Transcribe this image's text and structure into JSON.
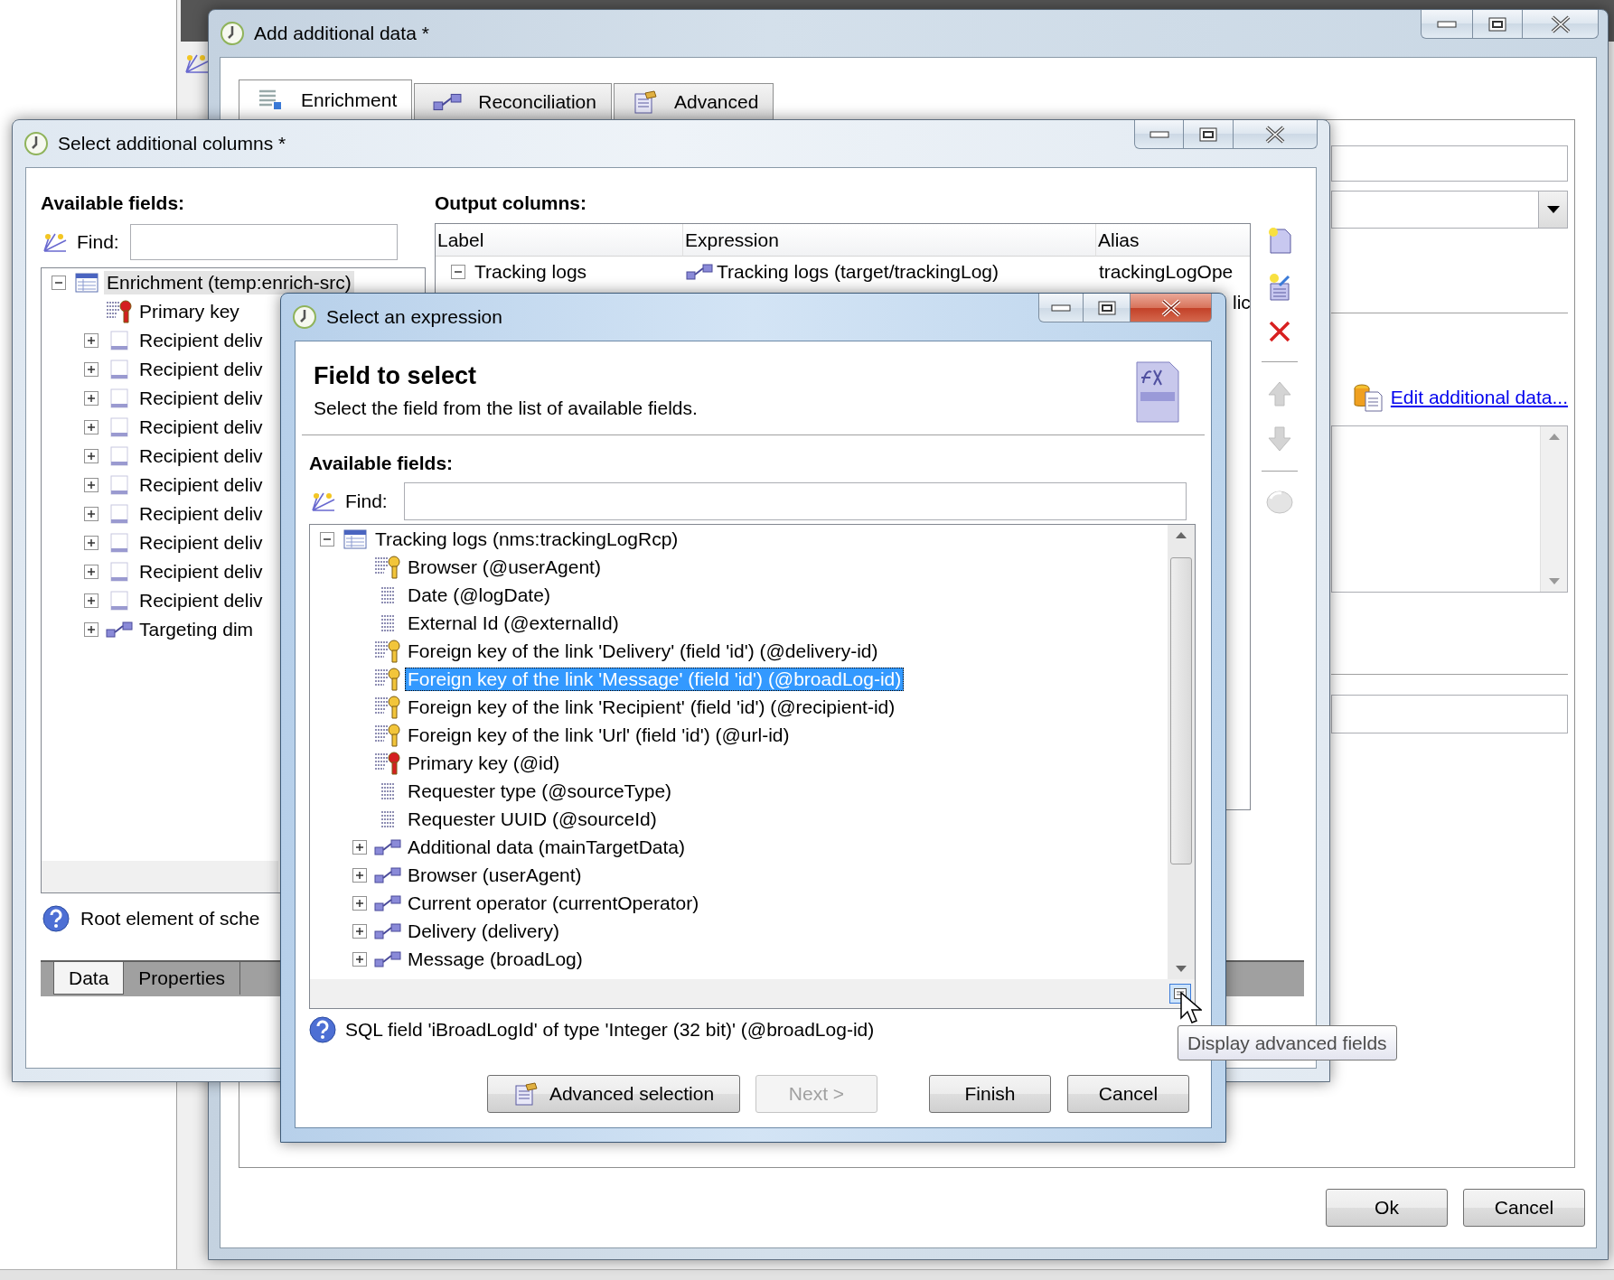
{
  "main_window": {
    "title": "Add additional data *",
    "tabs": [
      {
        "label": "Enrichment",
        "selected": true
      },
      {
        "label": "Reconciliation",
        "selected": false
      },
      {
        "label": "Advanced",
        "selected": false
      }
    ],
    "link": "Edit additional data...",
    "buttons": [
      "Ok",
      "Cancel"
    ]
  },
  "columns_window": {
    "title": "Select additional columns *",
    "available_label": "Available fields:",
    "find_label": "Find:",
    "tree": {
      "label": "Enrichment (temp:enrich-src)",
      "kind": "table",
      "expanded": true,
      "selected": true,
      "children": [
        {
          "label": "Primary key",
          "kind": "primary_key",
          "selected": false
        },
        {
          "label": "Recipient deliv",
          "kind": "node",
          "expanded": false,
          "selected": false
        },
        {
          "label": "Recipient deliv",
          "kind": "node",
          "expanded": false,
          "selected": false
        },
        {
          "label": "Recipient deliv",
          "kind": "node",
          "expanded": false,
          "selected": false
        },
        {
          "label": "Recipient deliv",
          "kind": "node",
          "expanded": false,
          "selected": false
        },
        {
          "label": "Recipient deliv",
          "kind": "node",
          "expanded": false,
          "selected": false
        },
        {
          "label": "Recipient deliv",
          "kind": "node",
          "expanded": false,
          "selected": false
        },
        {
          "label": "Recipient deliv",
          "kind": "node",
          "expanded": false,
          "selected": false
        },
        {
          "label": "Recipient deliv",
          "kind": "node",
          "expanded": false,
          "selected": false
        },
        {
          "label": "Recipient deliv",
          "kind": "node",
          "expanded": false,
          "selected": false
        },
        {
          "label": "Recipient deliv",
          "kind": "node",
          "expanded": false,
          "selected": false
        },
        {
          "label": "Targeting dim",
          "kind": "link",
          "expanded": false,
          "selected": false
        }
      ]
    },
    "output_label": "Output columns:",
    "columns": [
      "Label",
      "Expression",
      "Alias"
    ],
    "rows": [
      {
        "label": "Tracking logs",
        "expanded": true,
        "expression": "Tracking logs (target/trackingLog)",
        "alias": "trackingLogOpe"
      },
      {
        "alias": "lic"
      }
    ],
    "status": "Root element of sche",
    "tabs": [
      {
        "label": "Data",
        "selected": true
      },
      {
        "label": "Properties",
        "selected": false
      }
    ]
  },
  "expression_dialog": {
    "title": "Select an expression",
    "heading": "Field to select",
    "subheading": "Select the field from the list of available fields.",
    "available_label": "Available fields:",
    "find_label": "Find:",
    "tree": {
      "label": "Tracking logs (nms:trackingLogRcp)",
      "kind": "table",
      "expanded": true,
      "selected": false,
      "children": [
        {
          "label": "Browser (@userAgent)",
          "kind": "key",
          "selected": false
        },
        {
          "label": "Date (@logDate)",
          "kind": "field",
          "selected": false
        },
        {
          "label": "External Id (@externalId)",
          "kind": "field",
          "selected": false
        },
        {
          "label": "Foreign key of the link 'Delivery' (field 'id') (@delivery-id)",
          "kind": "key",
          "selected": false
        },
        {
          "label": "Foreign key of the link 'Message' (field 'id') (@broadLog-id)",
          "kind": "key",
          "selected": true
        },
        {
          "label": "Foreign key of the link 'Recipient' (field 'id') (@recipient-id)",
          "kind": "key",
          "selected": false
        },
        {
          "label": "Foreign key of the link 'Url' (field 'id') (@url-id)",
          "kind": "key",
          "selected": false
        },
        {
          "label": "Primary key (@id)",
          "kind": "primary_key",
          "selected": false
        },
        {
          "label": "Requester type (@sourceType)",
          "kind": "field",
          "selected": false
        },
        {
          "label": "Requester UUID (@sourceId)",
          "kind": "field",
          "selected": false
        },
        {
          "label": "Additional data (mainTargetData)",
          "kind": "link",
          "expanded": false,
          "selected": false
        },
        {
          "label": "Browser (userAgent)",
          "kind": "link",
          "expanded": false,
          "selected": false
        },
        {
          "label": "Current operator (currentOperator)",
          "kind": "link",
          "expanded": false,
          "selected": false
        },
        {
          "label": "Delivery (delivery)",
          "kind": "link",
          "expanded": false,
          "selected": false
        },
        {
          "label": "Message (broadLog)",
          "kind": "link",
          "expanded": false,
          "selected": false
        }
      ]
    },
    "status": "SQL field 'iBroadLogId' of type 'Integer (32 bit)' (@broadLog-id)",
    "buttons": [
      {
        "label": "Advanced selection",
        "kind": "icon_button",
        "disabled": false
      },
      {
        "label": "Next >",
        "kind": "button",
        "disabled": true
      },
      {
        "label": "Finish",
        "kind": "button",
        "disabled": false
      },
      {
        "label": "Cancel",
        "kind": "button",
        "disabled": false
      }
    ]
  },
  "tooltip": "Display advanced fields"
}
